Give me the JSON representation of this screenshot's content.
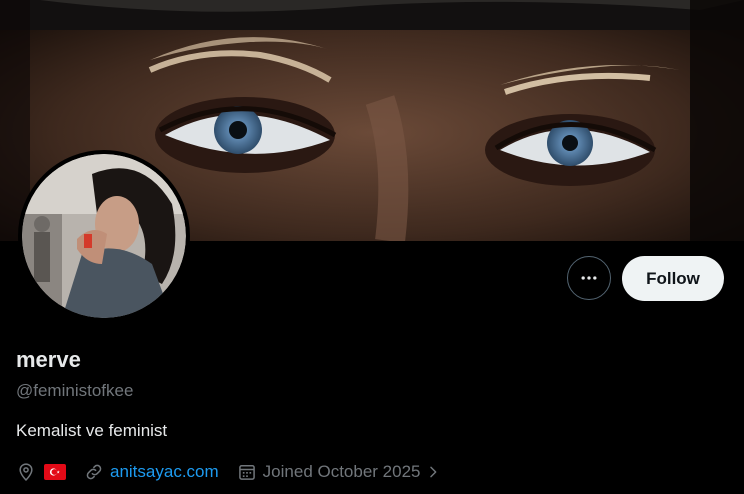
{
  "profile": {
    "display_name": "merve",
    "handle": "@feministofkee",
    "bio": "Kemalist ve feminist",
    "location_flag": "Turkey flag",
    "website": "anitsayac.com",
    "joined": "Joined October 2025"
  },
  "actions": {
    "more_icon": "more-horizontal-icon",
    "follow_label": "Follow"
  },
  "icons": {
    "location": "location-pin-icon",
    "link": "link-icon",
    "calendar": "calendar-icon",
    "chevron": "chevron-right-icon"
  },
  "colors": {
    "background": "#000000",
    "text_primary": "#e7e9ea",
    "text_secondary": "#71767b",
    "link": "#1d9bf0",
    "follow_bg": "#eff3f4",
    "flag_red": "#e30a17"
  }
}
